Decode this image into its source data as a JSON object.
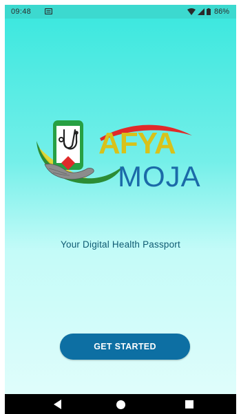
{
  "status_bar": {
    "time": "09:48",
    "battery_percent": "86%",
    "icons": [
      "notification-icon",
      "wifi-icon",
      "signal-icon",
      "battery-icon"
    ]
  },
  "logo": {
    "brand_top": "AFYA",
    "brand_bottom": "MOJA",
    "colors": {
      "afya_yellow": "#d8c21a",
      "moja_blue": "#1b6aa8",
      "swoosh_red": "#e02a2a",
      "leaf_green": "#2c8c35"
    }
  },
  "main": {
    "tagline": "Your Digital Health Passport",
    "get_started_label": "GET STARTED"
  },
  "nav_bar": {
    "icons": [
      "back-icon",
      "home-icon",
      "recents-icon"
    ]
  },
  "colors": {
    "gradient_top": "#3ee8df",
    "gradient_bottom": "#dffdfb",
    "button": "#0d6fa3",
    "tagline_text": "#0e5a72"
  }
}
